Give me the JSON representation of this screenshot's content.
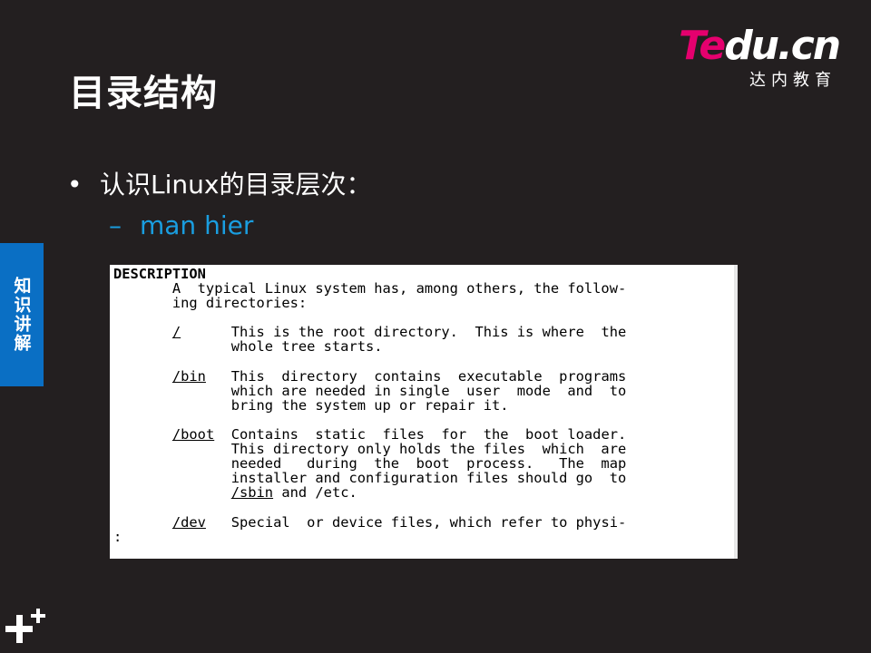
{
  "slide": {
    "title": "目录结构",
    "logo_main_part1": "Te",
    "logo_main_part2": "du.cn",
    "logo_sub": "达内教育",
    "side_tab": "知识讲解",
    "bullet": "认识Linux的目录层次：",
    "sub_bullet": "man  hier"
  },
  "terminal": {
    "header": "DESCRIPTION",
    "lines": [
      "       A  typical Linux system has, among others, the follow-",
      "       ing directories:",
      "",
      "       /      This is the root directory.  This is where  the",
      "              whole tree starts.",
      "",
      "       /bin   This  directory  contains  executable  programs",
      "              which are needed in single  user  mode  and  to",
      "              bring the system up or repair it.",
      "",
      "       /boot  Contains  static  files  for  the  boot loader.",
      "              This directory only holds the files  which  are",
      "              needed   during  the  boot  process.   The  map",
      "              installer and configuration files should go  to",
      "              /sbin and /etc.",
      "",
      "       /dev   Special  or device files, which refer to physi-",
      ":"
    ]
  }
}
